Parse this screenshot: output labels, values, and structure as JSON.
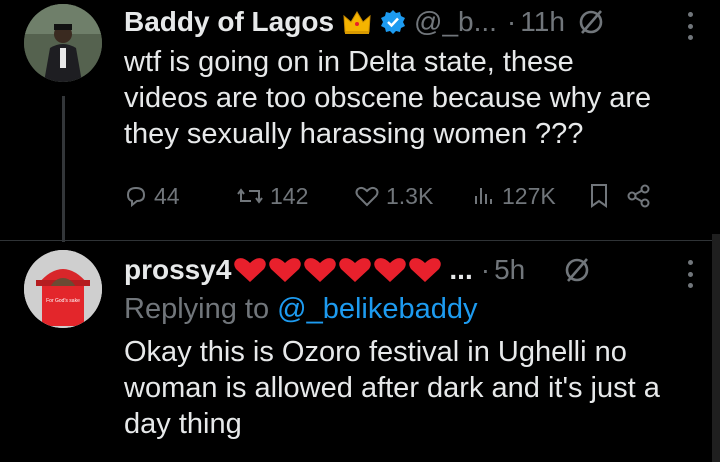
{
  "post1": {
    "display_name": "Baddy of Lagos",
    "handle": "@_b...",
    "separator": "·",
    "time": "11h",
    "text": "wtf is going on in Delta state, these videos are too obscene because why are they sexually harassing women ???",
    "replies": "44",
    "reposts": "142",
    "likes": "1.3K",
    "views": "127K"
  },
  "post2": {
    "display_name": "prossy4",
    "ellipsis": "...",
    "separator": "·",
    "time": "5h",
    "replying_prefix": "Replying to",
    "replying_handle": "@_belikebaddy",
    "text": "Okay this is Ozoro festival in  Ughelli  no woman is allowed after dark and it's just a day thing",
    "avatar_sign_text": "For God's sake"
  },
  "colors": {
    "background": "#000000",
    "text": "#e7e9ea",
    "muted": "#71767b",
    "link": "#1d9bf0",
    "verified": "#1d9bf0",
    "heart": "#e8202c",
    "crown": "#f5b400"
  }
}
